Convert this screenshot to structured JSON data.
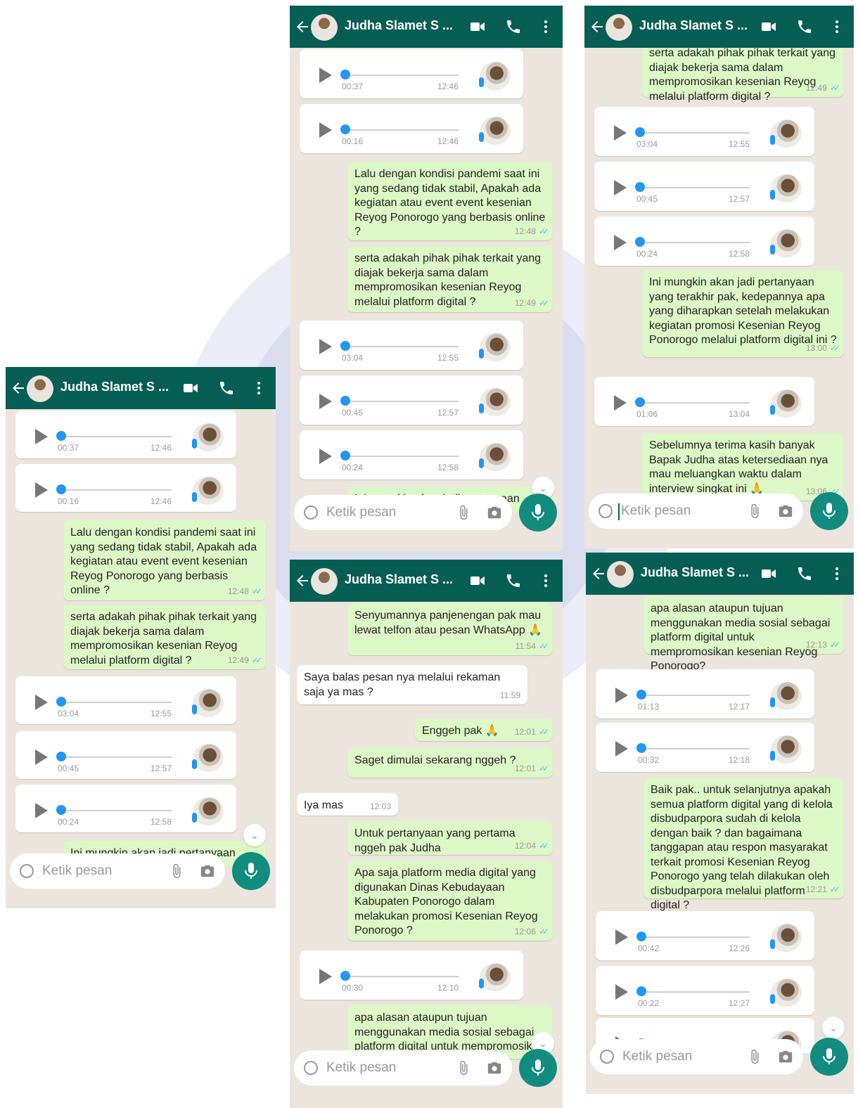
{
  "header": {
    "contact_name": "Judha Slamet S ..."
  },
  "input": {
    "placeholder": "Ketik pesan"
  },
  "colors": {
    "header": "#075e54",
    "chat_bg": "#ece5dd",
    "outgoing": "#dcf8c6",
    "incoming": "#ffffff",
    "accent": "#128c7e",
    "read_tick": "#4fc3f7"
  },
  "icons": [
    "back-arrow-icon",
    "video-call-icon",
    "phone-icon",
    "more-vert-icon",
    "play-icon",
    "mic-icon",
    "emoji-icon",
    "attach-icon",
    "camera-icon",
    "chevron-down-icon",
    "double-check-icon",
    "pray-emoji-icon"
  ],
  "screens": [
    {
      "id": "s1",
      "messages": [
        {
          "type": "voice",
          "duration": "00:37",
          "time": "12:46"
        },
        {
          "type": "voice",
          "duration": "00:16",
          "time": "12:46"
        },
        {
          "type": "text",
          "dir": "out",
          "text": "Lalu dengan kondisi pandemi saat ini yang sedang tidak stabil, Apakah ada kegiatan atau event event kesenian Reyog Ponorogo yang berbasis online ?",
          "time": "12:48"
        },
        {
          "type": "text",
          "dir": "out",
          "text": "serta adakah pihak pihak terkait yang diajak bekerja sama dalam mempromosikan kesenian Reyog melalui platform digital ?",
          "time": "12:49"
        },
        {
          "type": "voice",
          "duration": "03:04",
          "time": "12:55"
        },
        {
          "type": "voice",
          "duration": "00:45",
          "time": "12:57"
        },
        {
          "type": "voice",
          "duration": "00:24",
          "time": "12:58"
        },
        {
          "type": "text",
          "dir": "out",
          "text": "Ini mungkin akan jadi pertanyaan",
          "time": ""
        }
      ]
    },
    {
      "id": "s2",
      "messages": [
        {
          "type": "voice",
          "duration": "00:37",
          "time": "12:46"
        },
        {
          "type": "voice",
          "duration": "00:16",
          "time": "12:46"
        },
        {
          "type": "text",
          "dir": "out",
          "text": "Lalu dengan kondisi pandemi saat ini yang sedang tidak stabil, Apakah ada kegiatan atau event event kesenian Reyog Ponorogo yang berbasis online ?",
          "time": "12:48"
        },
        {
          "type": "text",
          "dir": "out",
          "text": "serta adakah pihak pihak terkait yang diajak bekerja sama dalam mempromosikan kesenian Reyog melalui platform digital ?",
          "time": "12:49"
        },
        {
          "type": "voice",
          "duration": "03:04",
          "time": "12:55"
        },
        {
          "type": "voice",
          "duration": "00:45",
          "time": "12:57"
        },
        {
          "type": "voice",
          "duration": "00:24",
          "time": "12:58"
        },
        {
          "type": "text",
          "dir": "out",
          "text": "Ini mungkin akan jadi pertanyaan",
          "time": ""
        }
      ]
    },
    {
      "id": "s3",
      "messages": [
        {
          "type": "text",
          "dir": "out",
          "text": "serta adakah pihak pihak terkait yang diajak bekerja sama dalam mempromosikan kesenian Reyog melalui platform digital ?",
          "time": "12:49"
        },
        {
          "type": "voice",
          "duration": "03:04",
          "time": "12:55"
        },
        {
          "type": "voice",
          "duration": "00:45",
          "time": "12:57"
        },
        {
          "type": "voice",
          "duration": "00:24",
          "time": "12:58"
        },
        {
          "type": "text",
          "dir": "out",
          "text": "Ini mungkin akan jadi pertanyaan yang terakhir pak, kedepannya apa yang diharapkan setelah melakukan kegiatan promosi Kesenian Reyog Ponorogo melalui platform digital ini ?",
          "time": "13:00"
        },
        {
          "type": "voice",
          "duration": "01:06",
          "time": "13:04"
        },
        {
          "type": "text",
          "dir": "out",
          "text": "Sebelumnya terima kasih banyak Bapak Judha atas ketersediaan nya mau meluangkan waktu dalam interview singkat ini 🙏",
          "time": "13:06"
        }
      ]
    },
    {
      "id": "s4",
      "messages": [
        {
          "type": "text",
          "dir": "out",
          "text": "Senyumannya panjenengan pak mau lewat telfon atau pesan WhatsApp 🙏",
          "time": "11:54"
        },
        {
          "type": "text",
          "dir": "in",
          "text": "Saya balas pesan nya melalui rekaman saja ya mas ?",
          "time": "11:59"
        },
        {
          "type": "text",
          "dir": "out",
          "text": "Enggeh pak 🙏",
          "time": "12:01"
        },
        {
          "type": "text",
          "dir": "out",
          "text": "Saget dimulai sekarang nggeh ?",
          "time": "12:01"
        },
        {
          "type": "text",
          "dir": "in",
          "text": "Iya mas",
          "time": "12:03"
        },
        {
          "type": "text",
          "dir": "out",
          "text": "Untuk pertanyaan yang pertama nggeh pak Judha",
          "time": "12:04"
        },
        {
          "type": "text",
          "dir": "out",
          "text": "Apa saja platform media digital yang digunakan Dinas Kebudayaan Kabupaten Ponorogo dalam melakukan promosi Kesenian Reyog Ponorogo ?",
          "time": "12:06"
        },
        {
          "type": "voice",
          "duration": "00:30",
          "time": "12:10"
        },
        {
          "type": "text",
          "dir": "out",
          "text": "apa alasan ataupun tujuan menggunakan media sosial sebagai platform digital untuk mempromosikan kesenian Reyog Ponorogo?",
          "time": ""
        }
      ]
    },
    {
      "id": "s5",
      "messages": [
        {
          "type": "text",
          "dir": "out",
          "text": "apa alasan ataupun tujuan menggunakan media sosial sebagai platform digital untuk mempromosikan kesenian Reyog Ponorogo?",
          "time": "12:13"
        },
        {
          "type": "voice",
          "duration": "01:13",
          "time": "12:17"
        },
        {
          "type": "voice",
          "duration": "00:32",
          "time": "12:18"
        },
        {
          "type": "text",
          "dir": "out",
          "text": "Baik pak.. untuk selanjutnya apakah semua platform digital yang di kelola disbudparpora sudah di kelola dengan baik ? dan bagaimana tanggapan atau respon masyarakat terkait promosi Kesenian Reyog Ponorogo yang telah dilakukan oleh disbudparpora melalui platform digital ?",
          "time": "12:21"
        },
        {
          "type": "voice",
          "duration": "00:42",
          "time": "12:26"
        },
        {
          "type": "voice",
          "duration": "00:22",
          "time": "12:27"
        },
        {
          "type": "voice",
          "duration": "",
          "time": ""
        }
      ]
    }
  ]
}
